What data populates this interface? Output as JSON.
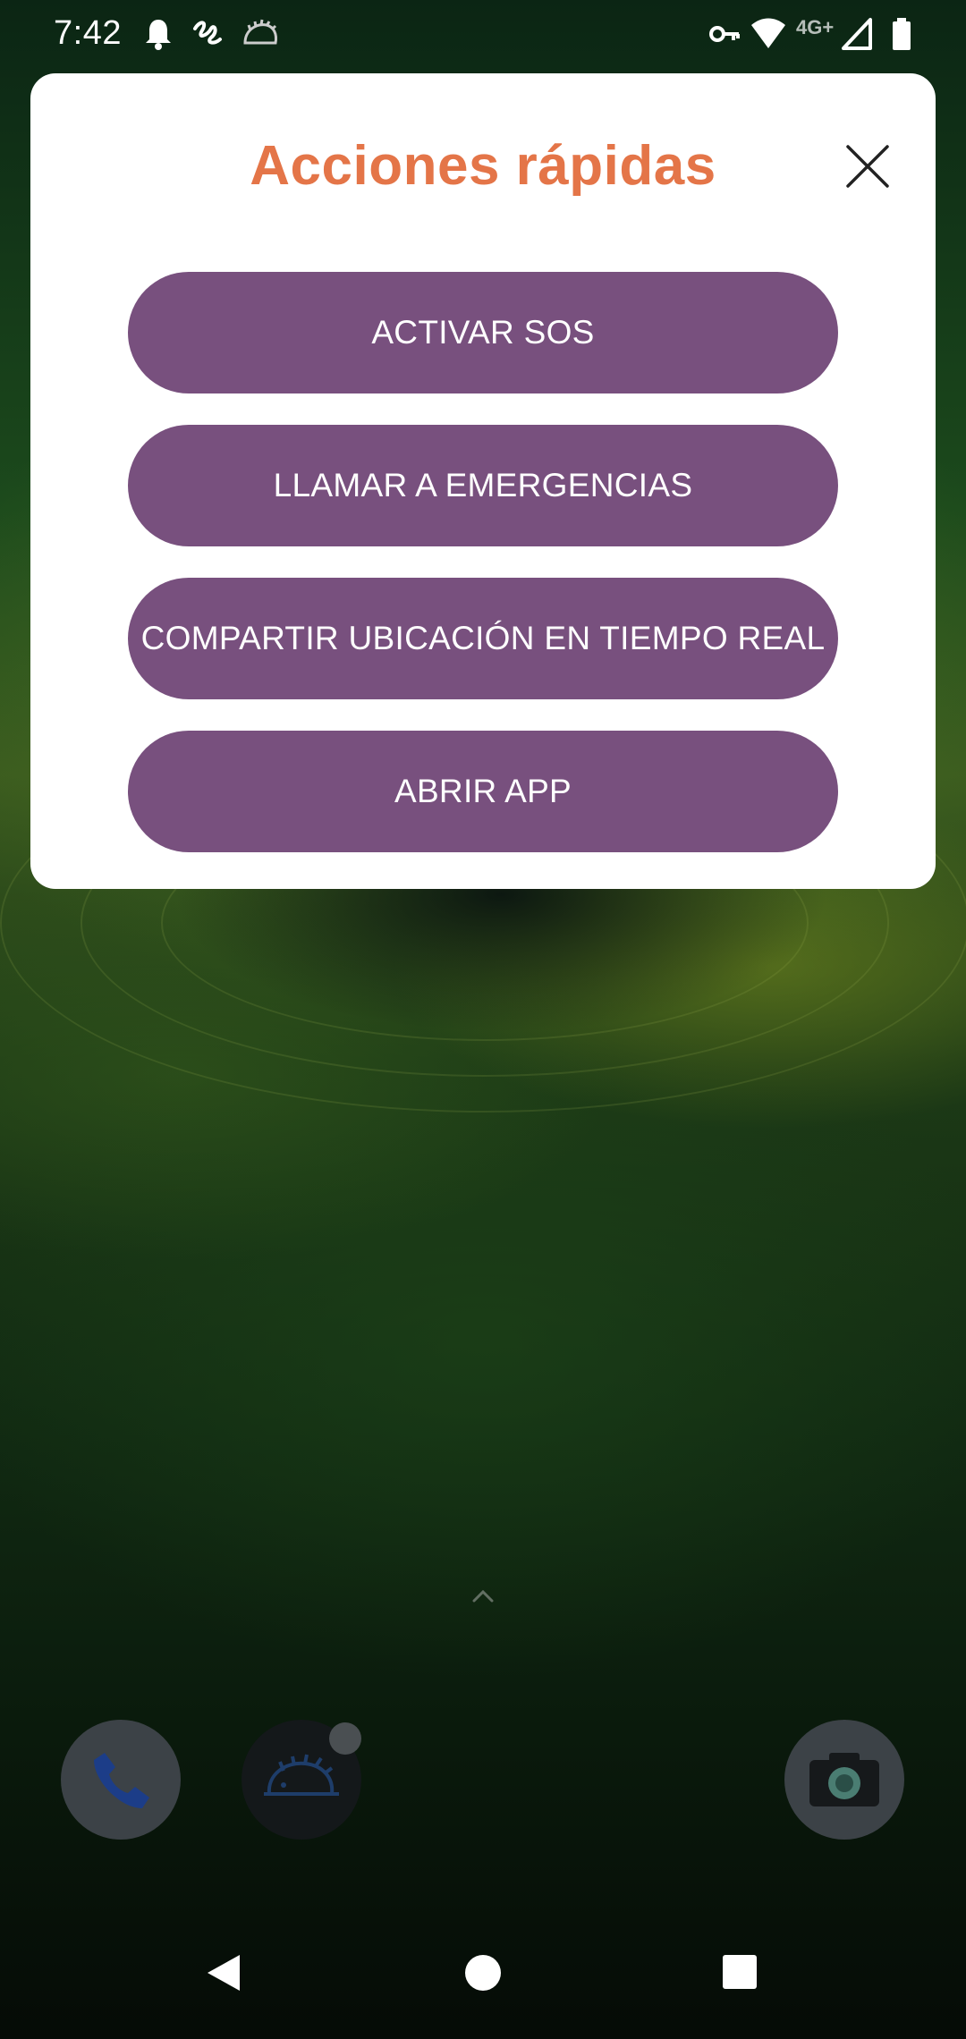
{
  "status_bar": {
    "time": "7:42",
    "network_label": "4G+",
    "icons": [
      "notification-bell-icon",
      "scribble-app-icon",
      "hedgehog-app-icon",
      "vpn-key-icon",
      "wifi-icon",
      "cell-signal-icon",
      "battery-icon"
    ]
  },
  "dialog": {
    "title": "Acciones rápidas",
    "close_icon": "close-icon",
    "buttons": [
      {
        "label": "ACTIVAR SOS"
      },
      {
        "label": "LLAMAR A EMERGENCIAS"
      },
      {
        "label": "COMPARTIR UBICACIÓN EN TIEMPO REAL"
      },
      {
        "label": "ABRIR APP"
      }
    ],
    "title_color": "#e47548",
    "button_color": "#78507e"
  },
  "home": {
    "swipe_indicator": "chevron-up-icon",
    "dock": [
      "phone-icon",
      "hedgehog-app-icon",
      "camera-icon"
    ]
  },
  "navigation": [
    "back-icon",
    "home-icon",
    "recents-icon"
  ]
}
